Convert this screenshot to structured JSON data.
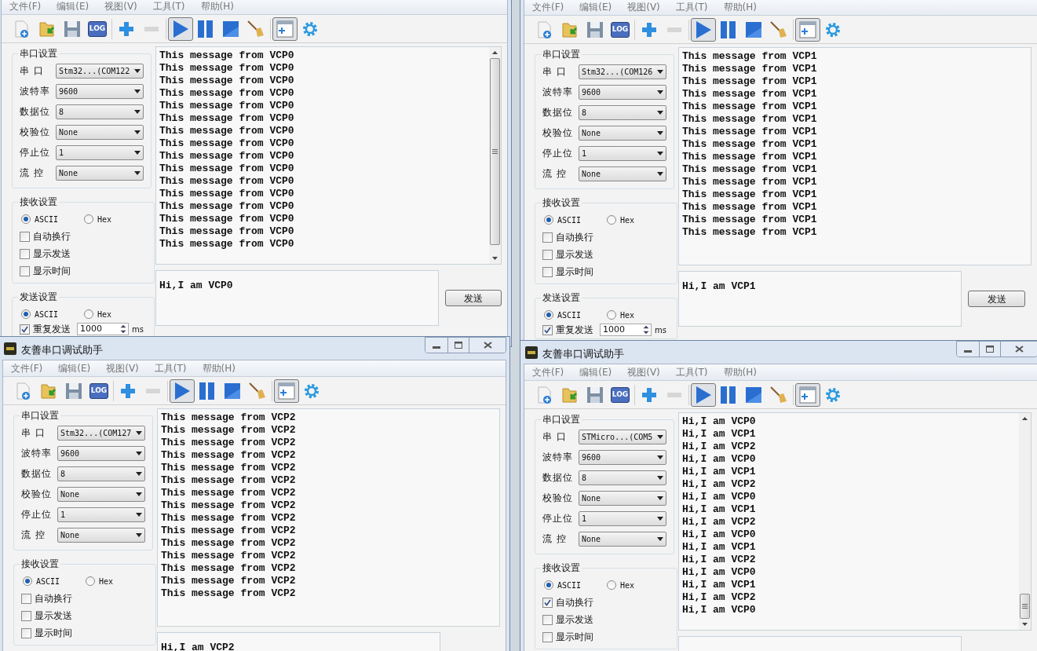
{
  "windows": [
    {
      "menu": [
        "文件(F)",
        "编辑(E)",
        "视图(V)",
        "工具(T)",
        "帮助(H)"
      ],
      "toolbar": [
        {
          "kind": "new",
          "pressed": false,
          "disabled": false
        },
        {
          "kind": "open",
          "pressed": false,
          "disabled": false
        },
        {
          "kind": "save",
          "pressed": false,
          "disabled": false
        },
        {
          "kind": "log",
          "label": "LOG",
          "pressed": false,
          "disabled": false
        },
        {
          "kind": "plus",
          "pressed": false,
          "disabled": false
        },
        {
          "kind": "minus",
          "pressed": false,
          "disabled": true
        },
        {
          "kind": "play",
          "pressed": true,
          "disabled": false
        },
        {
          "kind": "pause",
          "pressed": false,
          "disabled": false
        },
        {
          "kind": "stop",
          "pressed": false,
          "disabled": false
        },
        {
          "kind": "broom",
          "pressed": false,
          "disabled": false
        },
        {
          "kind": "window-add",
          "pressed": true,
          "disabled": false
        },
        {
          "kind": "gear",
          "pressed": false,
          "disabled": false
        }
      ],
      "serial": {
        "heading": "串口设置",
        "rows": [
          {
            "label": "串 口",
            "value": "Stm32...(COM122"
          },
          {
            "label": "波特率",
            "value": "9600"
          },
          {
            "label": "数据位",
            "value": "8"
          },
          {
            "label": "校验位",
            "value": "None"
          },
          {
            "label": "停止位",
            "value": "1"
          },
          {
            "label": "流 控",
            "value": "None"
          }
        ]
      },
      "receive_settings": {
        "heading": "接收设置",
        "modes": [
          {
            "label": "ASCII",
            "selected": true
          },
          {
            "label": "Hex",
            "selected": false
          }
        ],
        "options": [
          {
            "label": "自动换行",
            "checked": false
          },
          {
            "label": "显示发送",
            "checked": false
          },
          {
            "label": "显示时间",
            "checked": false
          }
        ]
      },
      "send_settings": {
        "heading": "发送设置",
        "modes": [
          {
            "label": "ASCII",
            "selected": true
          },
          {
            "label": "Hex",
            "selected": false
          }
        ],
        "repeat": {
          "label": "重复发送",
          "checked": true,
          "value": "1000",
          "unit": "ms"
        }
      },
      "receive_text": [
        "This message from VCP0",
        "This message from VCP0",
        "This message from VCP0",
        "This message from VCP0",
        "This message from VCP0",
        "This message from VCP0",
        "This message from VCP0",
        "This message from VCP0",
        "This message from VCP0",
        "This message from VCP0",
        "This message from VCP0",
        "This message from VCP0",
        "This message from VCP0",
        "This message from VCP0",
        "This message from VCP0",
        "This message from VCP0"
      ],
      "scrollbar": true,
      "scrolled_to_end": false,
      "send_text": "Hi,I am VCP0",
      "send_button": "发送"
    },
    {
      "menu": [
        "文件(F)",
        "编辑(E)",
        "视图(V)",
        "工具(T)",
        "帮助(H)"
      ],
      "toolbar": [
        {
          "kind": "new",
          "pressed": false,
          "disabled": false
        },
        {
          "kind": "open",
          "pressed": false,
          "disabled": false
        },
        {
          "kind": "save",
          "pressed": false,
          "disabled": false
        },
        {
          "kind": "log",
          "label": "LOG",
          "pressed": false,
          "disabled": false
        },
        {
          "kind": "plus",
          "pressed": false,
          "disabled": false
        },
        {
          "kind": "minus",
          "pressed": false,
          "disabled": true
        },
        {
          "kind": "play",
          "pressed": true,
          "disabled": false
        },
        {
          "kind": "pause",
          "pressed": false,
          "disabled": false
        },
        {
          "kind": "stop",
          "pressed": false,
          "disabled": false
        },
        {
          "kind": "broom",
          "pressed": false,
          "disabled": false
        },
        {
          "kind": "window-add",
          "pressed": true,
          "disabled": false
        },
        {
          "kind": "gear",
          "pressed": false,
          "disabled": false
        }
      ],
      "serial": {
        "heading": "串口设置",
        "rows": [
          {
            "label": "串 口",
            "value": "Stm32...(COM126"
          },
          {
            "label": "波特率",
            "value": "9600"
          },
          {
            "label": "数据位",
            "value": "8"
          },
          {
            "label": "校验位",
            "value": "None"
          },
          {
            "label": "停止位",
            "value": "1"
          },
          {
            "label": "流 控",
            "value": "None"
          }
        ]
      },
      "receive_settings": {
        "heading": "接收设置",
        "modes": [
          {
            "label": "ASCII",
            "selected": true
          },
          {
            "label": "Hex",
            "selected": false
          }
        ],
        "options": [
          {
            "label": "自动换行",
            "checked": false
          },
          {
            "label": "显示发送",
            "checked": false
          },
          {
            "label": "显示时间",
            "checked": false
          }
        ]
      },
      "send_settings": {
        "heading": "发送设置",
        "modes": [
          {
            "label": "ASCII",
            "selected": true
          },
          {
            "label": "Hex",
            "selected": false
          }
        ],
        "repeat": {
          "label": "重复发送",
          "checked": true,
          "value": "1000",
          "unit": "ms"
        }
      },
      "receive_text": [
        "This message from VCP1",
        "This message from VCP1",
        "This message from VCP1",
        "This message from VCP1",
        "This message from VCP1",
        "This message from VCP1",
        "This message from VCP1",
        "This message from VCP1",
        "This message from VCP1",
        "This message from VCP1",
        "This message from VCP1",
        "This message from VCP1",
        "This message from VCP1",
        "This message from VCP1",
        "This message from VCP1"
      ],
      "send_text": "Hi,I am VCP1",
      "send_button": "发送"
    },
    {
      "title": "友善串口调试助手",
      "menu": [
        "文件(F)",
        "编辑(E)",
        "视图(V)",
        "工具(T)",
        "帮助(H)"
      ],
      "toolbar": [
        {
          "kind": "new",
          "pressed": false,
          "disabled": false
        },
        {
          "kind": "open",
          "pressed": false,
          "disabled": false
        },
        {
          "kind": "save",
          "pressed": false,
          "disabled": false
        },
        {
          "kind": "log",
          "label": "LOG",
          "pressed": false,
          "disabled": false
        },
        {
          "kind": "plus",
          "pressed": false,
          "disabled": false
        },
        {
          "kind": "minus",
          "pressed": false,
          "disabled": true
        },
        {
          "kind": "play",
          "pressed": true,
          "disabled": false
        },
        {
          "kind": "pause",
          "pressed": false,
          "disabled": false
        },
        {
          "kind": "stop",
          "pressed": false,
          "disabled": false
        },
        {
          "kind": "broom",
          "pressed": false,
          "disabled": false
        },
        {
          "kind": "window-add",
          "pressed": true,
          "disabled": false
        },
        {
          "kind": "gear",
          "pressed": false,
          "disabled": false
        }
      ],
      "serial": {
        "heading": "串口设置",
        "rows": [
          {
            "label": "串 口",
            "value": "Stm32...(COM127"
          },
          {
            "label": "波特率",
            "value": "9600"
          },
          {
            "label": "数据位",
            "value": "8"
          },
          {
            "label": "校验位",
            "value": "None"
          },
          {
            "label": "停止位",
            "value": "1"
          },
          {
            "label": "流 控",
            "value": "None"
          }
        ]
      },
      "receive_settings": {
        "heading": "接收设置",
        "modes": [
          {
            "label": "ASCII",
            "selected": true
          },
          {
            "label": "Hex",
            "selected": false
          }
        ],
        "options": [
          {
            "label": "自动换行",
            "checked": false
          },
          {
            "label": "显示发送",
            "checked": false
          },
          {
            "label": "显示时间",
            "checked": false
          }
        ]
      },
      "receive_text": [
        "This message from VCP2",
        "This message from VCP2",
        "This message from VCP2",
        "This message from VCP2",
        "This message from VCP2",
        "This message from VCP2",
        "This message from VCP2",
        "This message from VCP2",
        "This message from VCP2",
        "This message from VCP2",
        "This message from VCP2",
        "This message from VCP2",
        "This message from VCP2",
        "This message from VCP2",
        "This message from VCP2"
      ],
      "send_text": "Hi,I am VCP2"
    },
    {
      "title": "友善串口调试助手",
      "menu": [
        "文件(F)",
        "编辑(E)",
        "视图(V)",
        "工具(T)",
        "帮助(H)"
      ],
      "toolbar": [
        {
          "kind": "new",
          "pressed": false,
          "disabled": false
        },
        {
          "kind": "open",
          "pressed": false,
          "disabled": false
        },
        {
          "kind": "save",
          "pressed": false,
          "disabled": false
        },
        {
          "kind": "log",
          "label": "LOG",
          "pressed": false,
          "disabled": false
        },
        {
          "kind": "plus",
          "pressed": false,
          "disabled": false
        },
        {
          "kind": "minus",
          "pressed": false,
          "disabled": true
        },
        {
          "kind": "play",
          "pressed": true,
          "disabled": false
        },
        {
          "kind": "pause",
          "pressed": false,
          "disabled": false
        },
        {
          "kind": "stop",
          "pressed": false,
          "disabled": false
        },
        {
          "kind": "broom",
          "pressed": false,
          "disabled": false
        },
        {
          "kind": "window-add",
          "pressed": true,
          "disabled": false
        },
        {
          "kind": "gear",
          "pressed": false,
          "disabled": false
        }
      ],
      "serial": {
        "heading": "串口设置",
        "rows": [
          {
            "label": "串 口",
            "value": "STMicro...(COM5"
          },
          {
            "label": "波特率",
            "value": "9600"
          },
          {
            "label": "数据位",
            "value": "8"
          },
          {
            "label": "校验位",
            "value": "None"
          },
          {
            "label": "停止位",
            "value": "1"
          },
          {
            "label": "流 控",
            "value": "None"
          }
        ]
      },
      "receive_settings": {
        "heading": "接收设置",
        "modes": [
          {
            "label": "ASCII",
            "selected": true
          },
          {
            "label": "Hex",
            "selected": false
          }
        ],
        "options": [
          {
            "label": "自动换行",
            "checked": true
          },
          {
            "label": "显示发送",
            "checked": false
          },
          {
            "label": "显示时间",
            "checked": false
          }
        ]
      },
      "receive_text": [
        "Hi,I am VCP0",
        "Hi,I am VCP1",
        "Hi,I am VCP2",
        "Hi,I am VCP0",
        "Hi,I am VCP1",
        "Hi,I am VCP2",
        "Hi,I am VCP0",
        "Hi,I am VCP1",
        "Hi,I am VCP2",
        "Hi,I am VCP0",
        "Hi,I am VCP1",
        "Hi,I am VCP2",
        "Hi,I am VCP0",
        "Hi,I am VCP1",
        "Hi,I am VCP2",
        "Hi,I am VCP0"
      ],
      "scrollbar": true,
      "scrolled_to_end": true
    }
  ]
}
